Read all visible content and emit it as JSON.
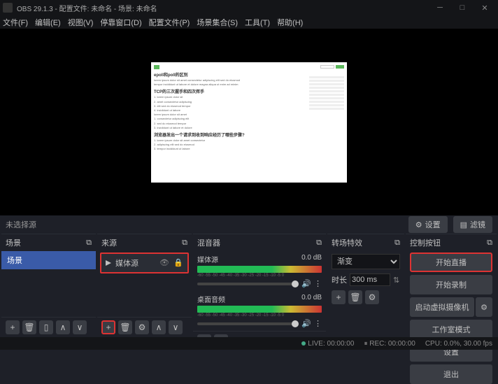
{
  "titlebar": {
    "title": "OBS 29.1.3 - 配置文件: 未命名 - 场景: 未命名"
  },
  "menu": {
    "file": "文件(F)",
    "edit": "编辑(E)",
    "view": "视图(V)",
    "dock": "停靠窗口(D)",
    "profile": "配置文件(P)",
    "scene_coll": "场景集合(S)",
    "tools": "工具(T)",
    "help": "帮助(H)"
  },
  "selection": {
    "label": "未选择源",
    "settings": "设置",
    "filters": "滤镜"
  },
  "panels": {
    "scenes": {
      "title": "场景",
      "items": [
        "场景"
      ]
    },
    "sources": {
      "title": "来源",
      "items": [
        {
          "name": "媒体源"
        }
      ]
    },
    "mixer": {
      "title": "混音器",
      "items": [
        {
          "name": "媒体源",
          "db": "0.0 dB",
          "ticks": "-60 -55 -50 -45 -40 -35 -30 -25 -20 -15 -10 -5 0"
        },
        {
          "name": "桌面音频",
          "db": "0.0 dB",
          "ticks": "-60 -55 -50 -45 -40 -35 -30 -25 -20 -15 -10 -5 0"
        }
      ]
    },
    "transitions": {
      "title": "转场特效",
      "type": "渐变",
      "duration_label": "时长",
      "duration": "300 ms"
    },
    "controls": {
      "title": "控制按钮",
      "start_stream": "开始直播",
      "start_rec": "开始录制",
      "virtual_cam": "启动虚拟摄像机",
      "studio": "工作室模式",
      "settings": "设置",
      "exit": "退出"
    }
  },
  "status": {
    "live": "LIVE: 00:00:00",
    "rec": "REC: 00:00:00",
    "cpu": "CPU: 0.0%, 30.00 fps"
  },
  "preview": {
    "h1": "epoll和poll的区别",
    "h2": "TCP的三次握手和四次挥手",
    "h3": "浏览器发出一个请求到收到响应经历了哪些步骤?"
  }
}
